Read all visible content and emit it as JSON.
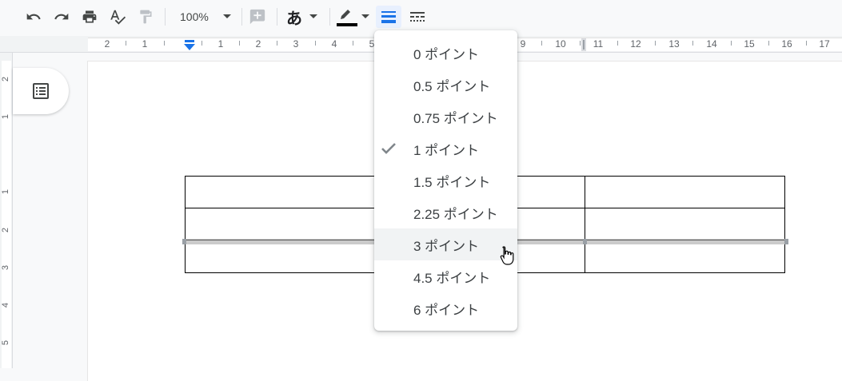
{
  "toolbar": {
    "zoom_value": "100%",
    "ime_label": "あ",
    "icons": [
      "undo-icon",
      "redo-icon",
      "print-icon",
      "spellcheck-icon",
      "paint-format-icon",
      "add-comment-icon",
      "pen-color-icon",
      "border-width-icon",
      "border-dash-icon"
    ],
    "accent_color": "#1a73e8"
  },
  "ruler": {
    "labels": [
      "2",
      "1",
      "1",
      "2",
      "3",
      "4",
      "5",
      "9",
      "10",
      "11",
      "12",
      "13",
      "14",
      "15",
      "16",
      "17"
    ]
  },
  "vertical_ruler": {
    "labels": [
      "2",
      "1",
      "1",
      "2",
      "3",
      "4",
      "5"
    ]
  },
  "border_width_menu": {
    "selected": "1 ポイント",
    "hovered": "3 ポイント",
    "items": [
      {
        "label": "0 ポイント"
      },
      {
        "label": "0.5 ポイント"
      },
      {
        "label": "0.75 ポイント"
      },
      {
        "label": "1 ポイント"
      },
      {
        "label": "1.5 ポイント"
      },
      {
        "label": "2.25 ポイント"
      },
      {
        "label": "3 ポイント"
      },
      {
        "label": "4.5 ポイント"
      },
      {
        "label": "6 ポイント"
      }
    ]
  },
  "document": {
    "table": {
      "rows": 3,
      "columns": 2
    }
  }
}
